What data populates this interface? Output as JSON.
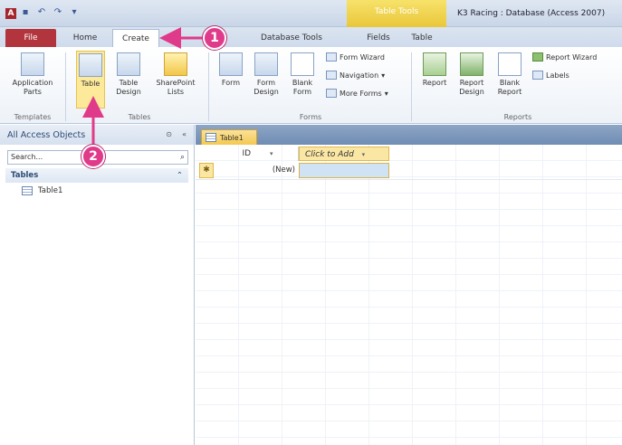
{
  "title_bar": {
    "app_icon": "A",
    "context_tab_group": "Table Tools",
    "window_title": "K3 Racing : Database (Access 2007)"
  },
  "tabs": [
    {
      "label": "File"
    },
    {
      "label": "Home"
    },
    {
      "label": "Create"
    },
    {
      "label": "Database Tools"
    },
    {
      "label": "Fields"
    },
    {
      "label": "Table"
    }
  ],
  "ribbon": {
    "groups": {
      "templates": "Templates",
      "tables": "Tables",
      "forms": "Forms",
      "reports": "Reports"
    },
    "buttons": {
      "application_parts": "Application Parts",
      "table": "Table",
      "table_design": "Table Design",
      "sharepoint_lists": "SharePoint Lists",
      "form": "Form",
      "form_design": "Form Design",
      "blank_form": "Blank Form",
      "form_wizard": "Form Wizard",
      "navigation": "Navigation",
      "more_forms": "More Forms",
      "report": "Report",
      "report_design": "Report Design",
      "blank_report": "Blank Report",
      "report_wizard": "Report Wizard",
      "labels": "Labels"
    }
  },
  "nav_pane": {
    "header": "All Access Objects",
    "search_value": "Search...",
    "group": "Tables",
    "items": [
      {
        "label": "Table1"
      }
    ]
  },
  "document": {
    "tab_label": "Table1",
    "columns": [
      {
        "label": "ID"
      },
      {
        "label": "Click to Add"
      }
    ],
    "new_row": {
      "selector": "✱",
      "id_value": "(New)"
    }
  },
  "callouts": [
    {
      "number": "1"
    },
    {
      "number": "2"
    }
  ],
  "colors": {
    "accent_callout": "#e03a8a",
    "file_tab": "#b2343c",
    "context_tab": "#e9c73a"
  }
}
